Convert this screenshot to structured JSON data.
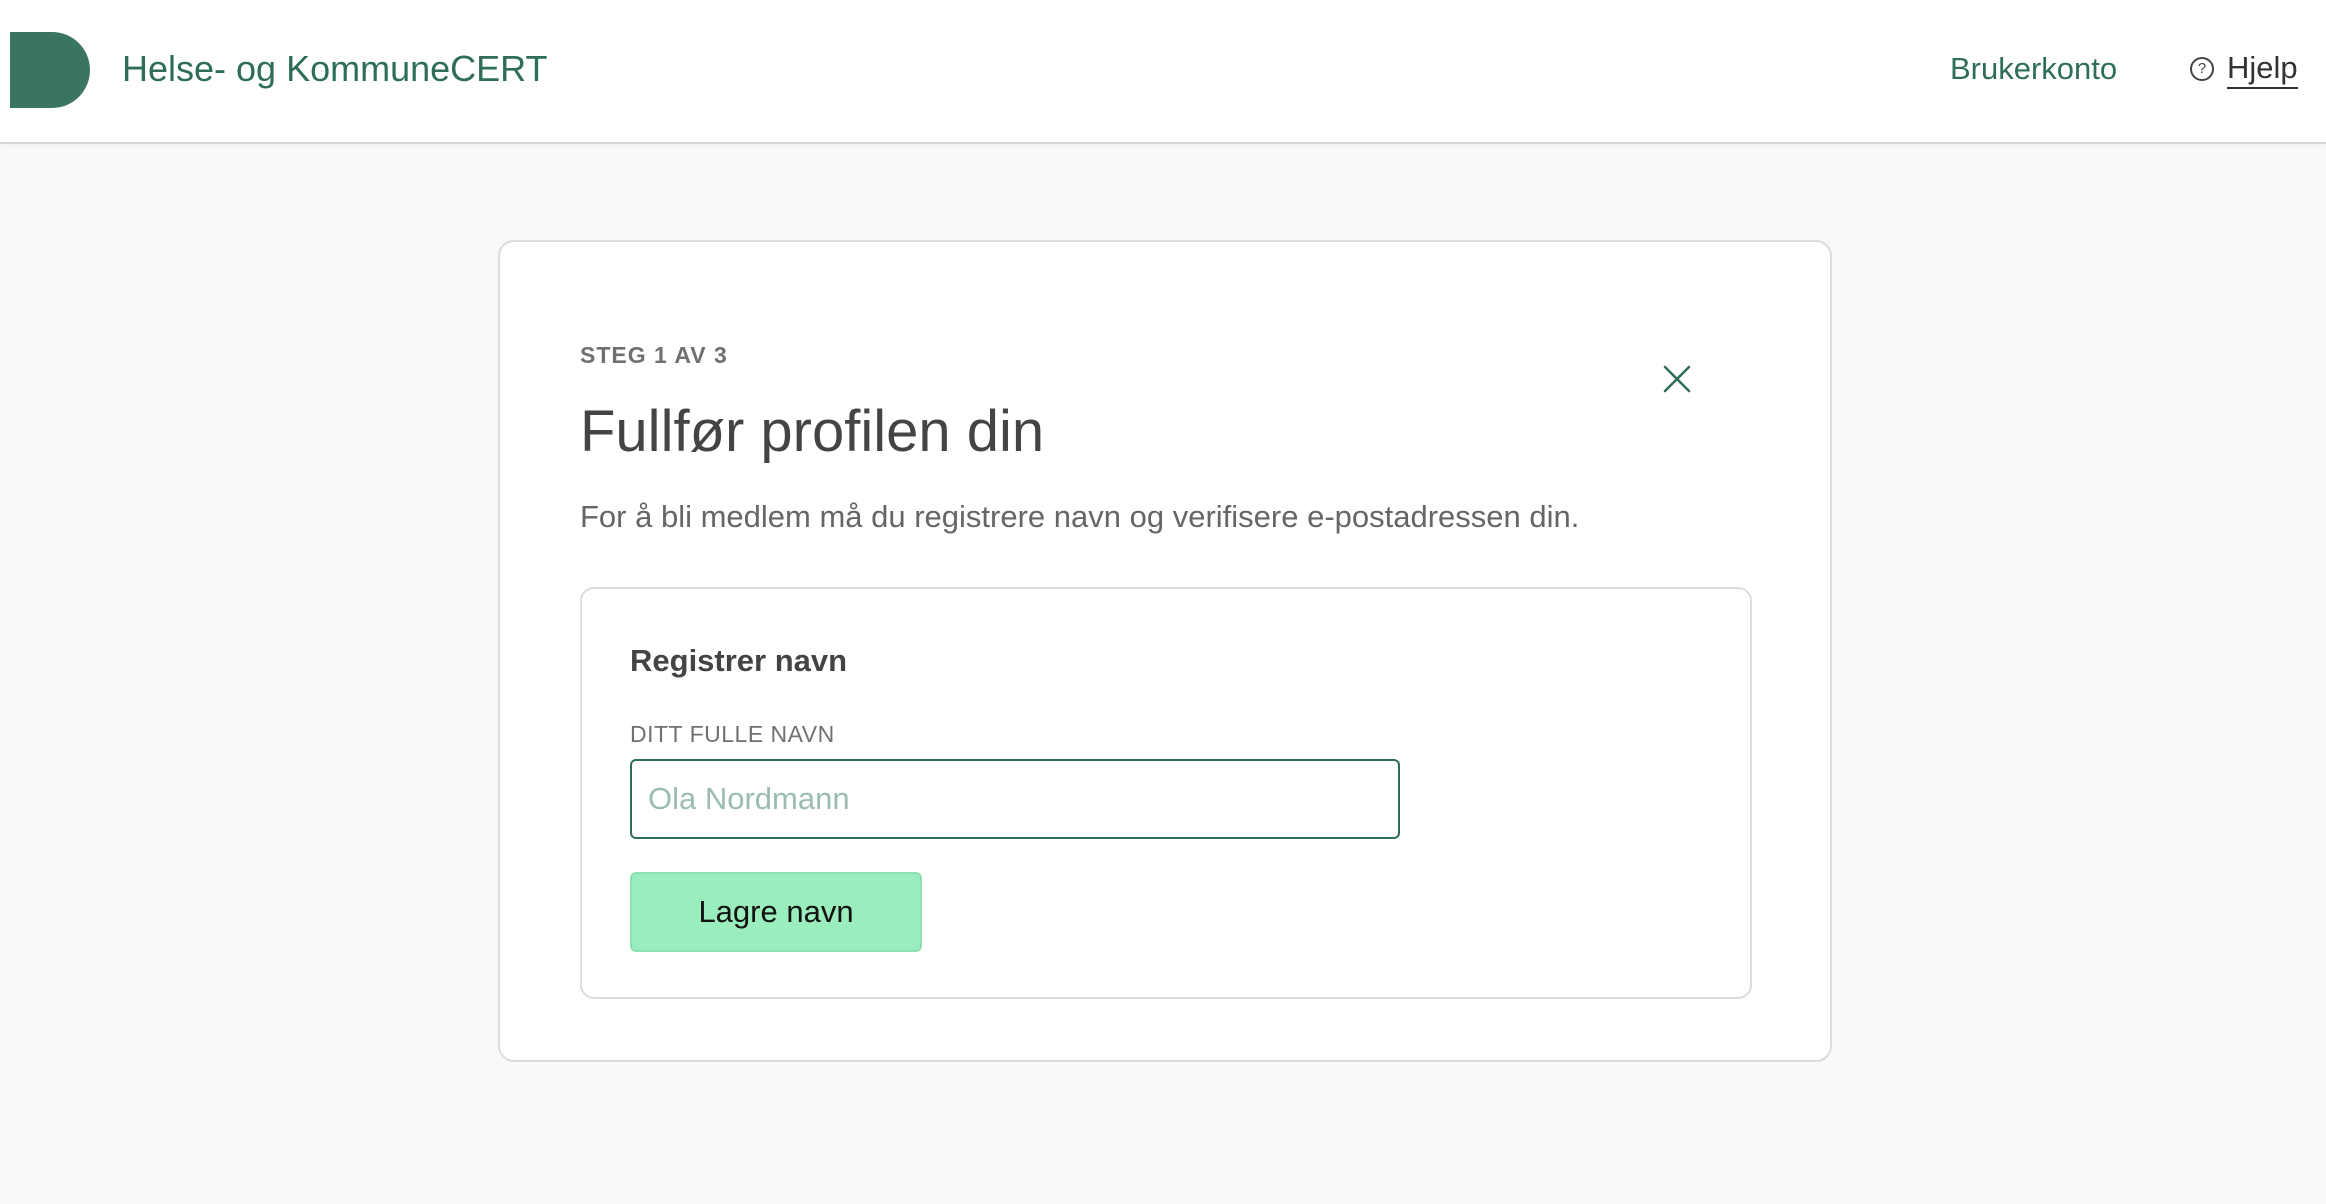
{
  "header": {
    "brand": "Helse- og KommuneCERT",
    "nav_account": "Brukerkonto",
    "nav_help": "Hjelp",
    "help_icon_glyph": "?"
  },
  "colors": {
    "brand_green": "#2e6e57",
    "logo_green": "#3a7561",
    "button_green": "#9aedbd"
  },
  "modal": {
    "step": "STEG 1 AV 3",
    "title": "Fullfør profilen din",
    "description": "For å bli medlem må du registrere navn og verifisere e-postadressen din.",
    "section": {
      "title": "Registrer navn",
      "field_label": "DITT FULLE NAVN",
      "field_placeholder": "Ola Nordmann",
      "field_value": "",
      "button": "Lagre navn"
    }
  },
  "icons": {
    "logo": "brand-logo",
    "help": "help-circle-icon",
    "close": "close-icon"
  }
}
